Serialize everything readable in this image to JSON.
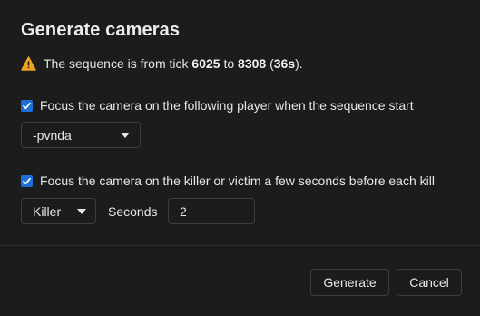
{
  "dialog": {
    "title": "Generate cameras",
    "warning": {
      "icon": "warning-icon",
      "text_prefix": "The sequence is from tick ",
      "start_tick": "6025",
      "text_to": " to ",
      "end_tick": "8308",
      "text_open": " (",
      "duration": "36s",
      "text_close": ")."
    },
    "focus_player": {
      "checked": true,
      "label": "Focus the camera on the following player when the sequence start",
      "selected_player": "-pvnda"
    },
    "focus_kill": {
      "checked": true,
      "label": "Focus the camera on the killer or victim a few seconds before each kill",
      "selected_target": "Killer",
      "seconds_label": "Seconds",
      "seconds_value": "2"
    },
    "buttons": {
      "generate": "Generate",
      "cancel": "Cancel"
    }
  },
  "colors": {
    "background": "#1c1c1c",
    "accent": "#1e6fd9",
    "warning": "#f0a020",
    "border": "#3d3d3d"
  }
}
